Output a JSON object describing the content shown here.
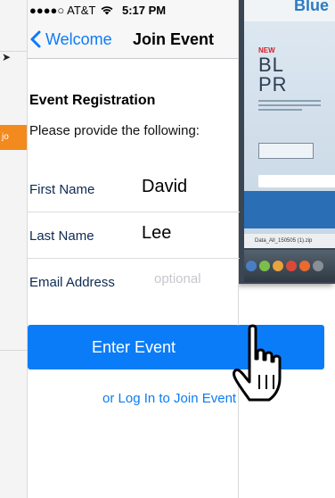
{
  "status_bar": {
    "carrier": "●●●●○ AT&T",
    "wifi_icon": "wifi-icon",
    "time": "5:17 PM"
  },
  "nav": {
    "back_label": "Welcome",
    "title": "Join Event"
  },
  "form": {
    "section_title": "Event Registration",
    "instructions": "Please provide the following:",
    "fields": [
      {
        "label": "First Name",
        "value": "David"
      },
      {
        "label": "Last Name",
        "value": "Lee"
      },
      {
        "label": "Email Address",
        "value": "",
        "placeholder": "optional"
      }
    ]
  },
  "actions": {
    "enter_label": "Enter Event",
    "login_link": "or Log In to Join Event"
  },
  "background": {
    "left_tab_text": "jo",
    "site_word": "Blue",
    "site_badge": "NEW",
    "site_heading_1": "BL",
    "site_heading_2": "PR",
    "taskbar_file": "Data_All_150505 (1).zip"
  },
  "colors": {
    "accent": "#0b7cf7",
    "orange": "#f28a1e",
    "label_text": "#0d2a52"
  }
}
